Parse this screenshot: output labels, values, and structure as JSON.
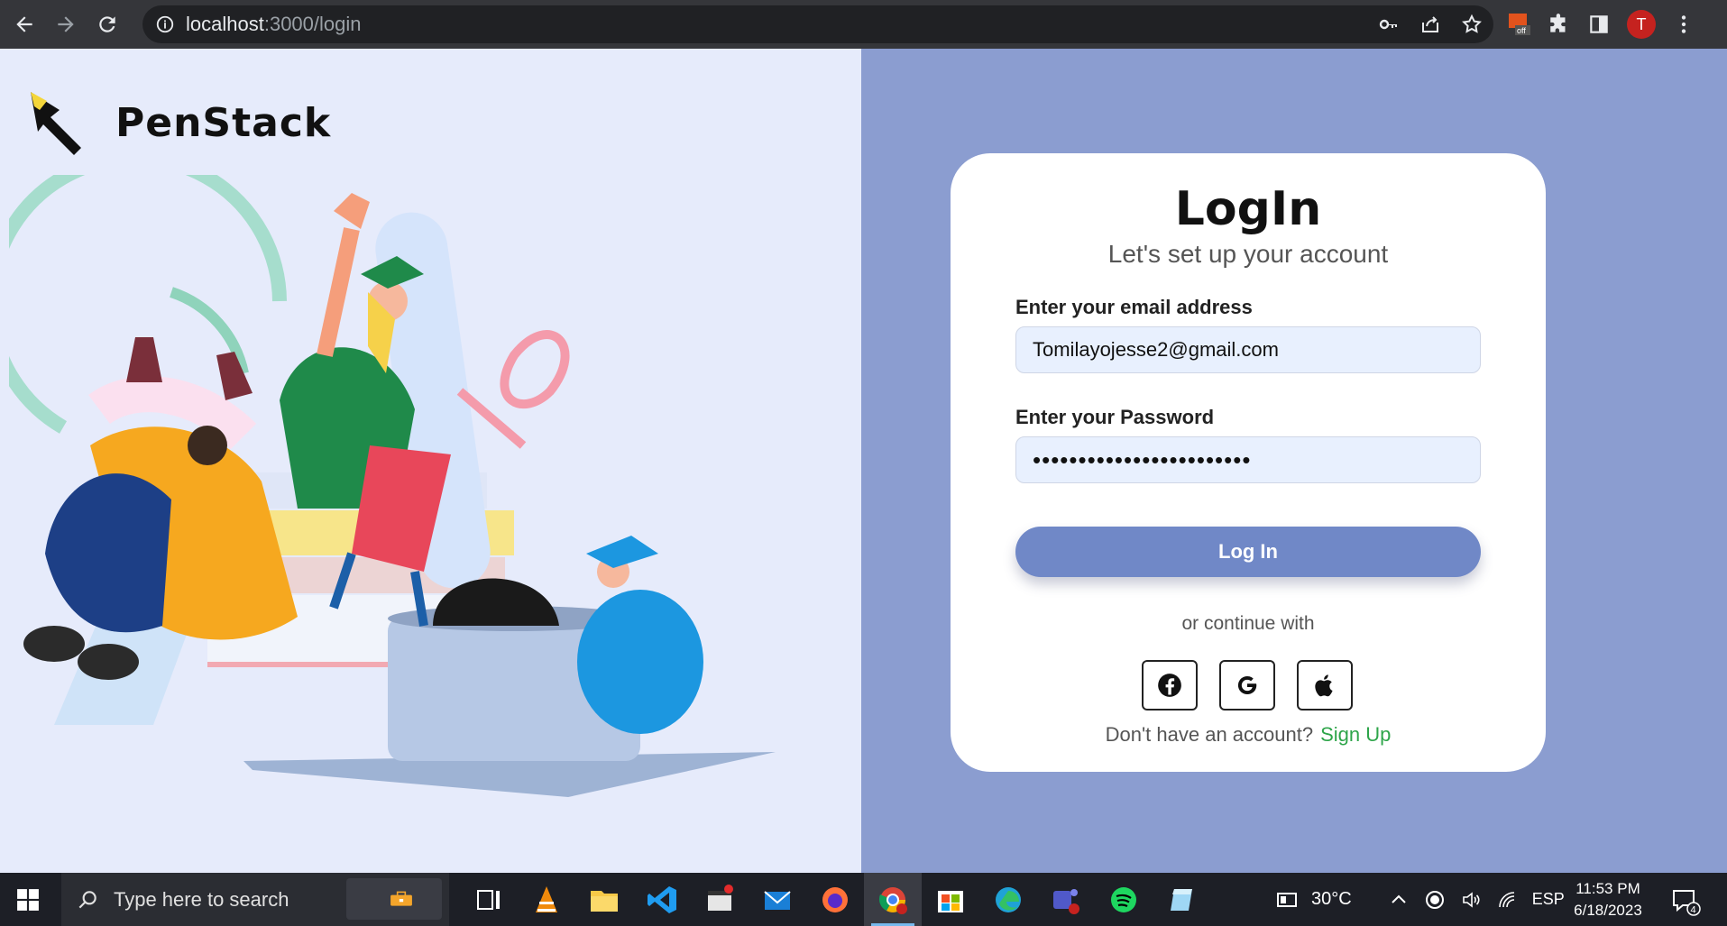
{
  "browser": {
    "url_host": "localhost",
    "url_path": ":3000/login",
    "profile_initial": "T",
    "ext_badge": "off"
  },
  "app": {
    "logo_text": "PenStack"
  },
  "login": {
    "title": "LogIn",
    "subtitle": "Let's set up your account",
    "email_label": "Enter your email address",
    "email_value": "Tomilayojesse2@gmail.com",
    "password_label": "Enter your Password",
    "password_value": "••••••••••••••••••••••••",
    "login_button": "Log In",
    "or_text": "or continue with",
    "social_buttons": [
      "facebook-icon",
      "google-icon",
      "apple-icon"
    ],
    "no_account_text": "Don't have an account?",
    "signup_link": "Sign Up"
  },
  "taskbar": {
    "search_placeholder": "Type here to search",
    "weather": "30°C",
    "language": "ESP",
    "time": "11:53 PM",
    "date": "6/18/2023",
    "notification_count": "4",
    "teams_badge": "2"
  },
  "colors": {
    "left_bg": "#e6ebfb",
    "right_bg": "#8b9dd0",
    "button": "#7088c7",
    "signup_link": "#2ea54a",
    "input_bg": "#e8f0fe"
  }
}
